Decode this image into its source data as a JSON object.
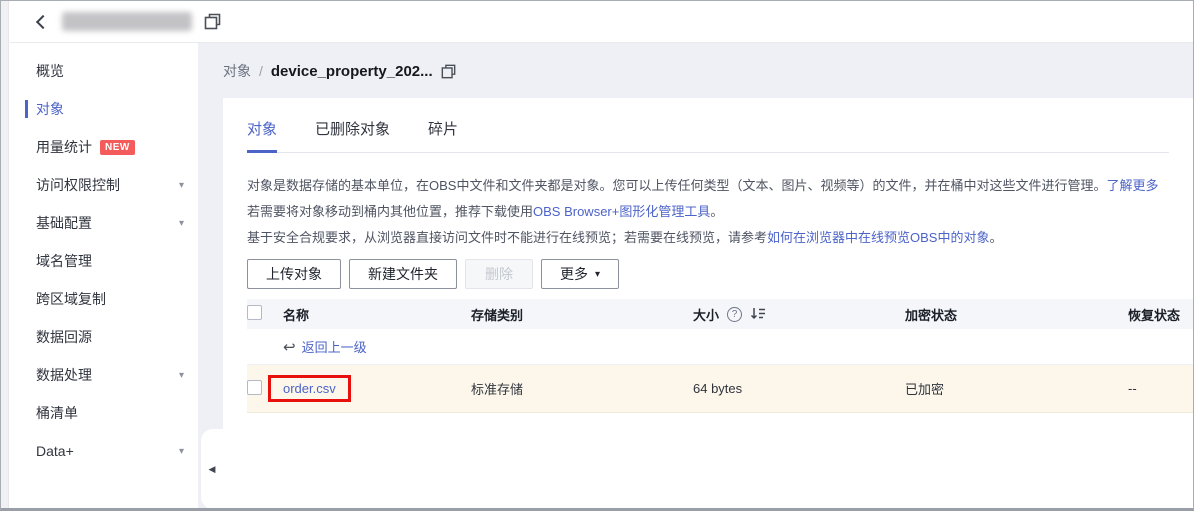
{
  "colors": {
    "accent_blue": "#4c63c8",
    "badge_red": "#f45c5c",
    "row_highlight": "#fcf7ea",
    "table_header_bg": "#f4f6fa",
    "annotation_red": "#e8100c",
    "main_bg": "#eef0f5"
  },
  "icons": {
    "back": "back-chevron",
    "copy": "copy",
    "chevron_down": "▾",
    "more_caret": "▾",
    "return_arrow": "↩",
    "help": "?",
    "collapse": "◀"
  },
  "sidebar": {
    "items": [
      {
        "label": "概览"
      },
      {
        "label": "对象",
        "active": true
      },
      {
        "label": "用量统计",
        "badge": "NEW"
      },
      {
        "label": "访问权限控制",
        "expandable": true
      },
      {
        "label": "基础配置",
        "expandable": true
      },
      {
        "label": "域名管理"
      },
      {
        "label": "跨区域复制"
      },
      {
        "label": "数据回源"
      },
      {
        "label": "数据处理",
        "expandable": true
      },
      {
        "label": "桶清单"
      },
      {
        "label": "Data+",
        "expandable": true
      }
    ]
  },
  "breadcrumb": {
    "root": "对象",
    "separator": "/",
    "current": "device_property_202..."
  },
  "tabs": [
    {
      "label": "对象",
      "active": true
    },
    {
      "label": "已删除对象"
    },
    {
      "label": "碎片"
    }
  ],
  "description": {
    "line1_text": "对象是数据存储的基本单位，在OBS中文件和文件夹都是对象。您可以上传任何类型（文本、图片、视频等）的文件，并在桶中对这些文件进行管理。",
    "line1_link": "了解更多",
    "line2_prefix": "若需要将对象移动到桶内其他位置，推荐下载使用",
    "line2_link": "OBS Browser+图形化管理工具",
    "line2_suffix": "。",
    "line3_prefix": "基于安全合规要求，从浏览器直接访问文件时不能进行在线预览；若需要在线预览，请参考",
    "line3_link": "如何在浏览器中在线预览OBS中的对象",
    "line3_suffix": "。"
  },
  "toolbar": {
    "upload_label": "上传对象",
    "new_folder_label": "新建文件夹",
    "delete_label": "删除",
    "more_label": "更多"
  },
  "table": {
    "headers": [
      "名称",
      "存储类别",
      "大小",
      "加密状态",
      "恢复状态"
    ],
    "return_link": "返回上一级",
    "rows": [
      {
        "name": "order.csv",
        "storage_class": "标准存储",
        "size": "64 bytes",
        "encryption": "已加密",
        "restore": "--"
      }
    ]
  }
}
